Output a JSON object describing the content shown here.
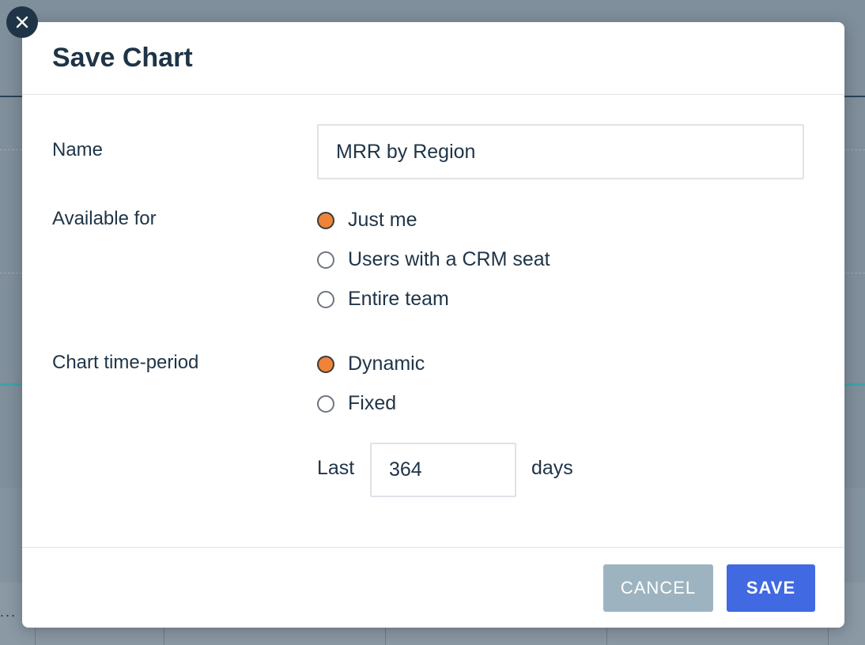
{
  "modal": {
    "title": "Save Chart",
    "close_icon": "close-icon"
  },
  "form": {
    "name_label": "Name",
    "name_value": "MRR by Region",
    "available_label": "Available for",
    "available_options": [
      {
        "label": "Just me",
        "checked": true
      },
      {
        "label": "Users with a CRM seat",
        "checked": false
      },
      {
        "label": "Entire team",
        "checked": false
      }
    ],
    "period_label": "Chart time-period",
    "period_options": [
      {
        "label": "Dynamic",
        "checked": true
      },
      {
        "label": "Fixed",
        "checked": false
      }
    ],
    "last_label": "Last",
    "days_value": "364",
    "days_label": "days"
  },
  "footer": {
    "cancel_label": "CANCEL",
    "save_label": "SAVE"
  },
  "background": {
    "dots": "..."
  },
  "colors": {
    "radio_checked": "#ee8438",
    "save_button": "#4169e1",
    "cancel_button": "#9db4c0",
    "text": "#1f3447"
  }
}
